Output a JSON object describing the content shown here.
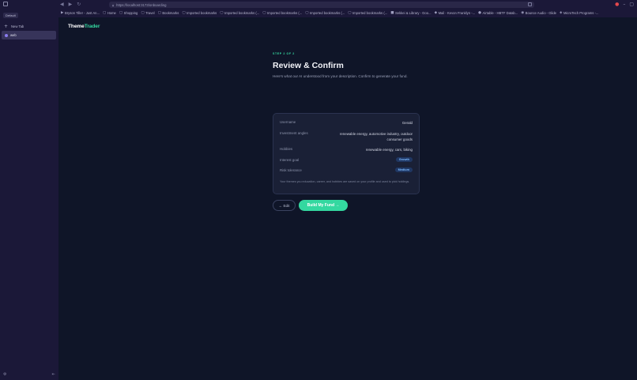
{
  "browser": {
    "url": "https://localhost:3173/onboarding",
    "profile_label": "Default",
    "new_tab_label": "New Tab",
    "active_tab_label": "web",
    "bookmarks": [
      {
        "icon": "▶",
        "label": "Bryson Tiller - Just An..."
      },
      {
        "icon": "▢",
        "label": "Home"
      },
      {
        "icon": "▢",
        "label": "Shopping"
      },
      {
        "icon": "▢",
        "label": "Travel"
      },
      {
        "icon": "▢",
        "label": "Bookmarks"
      },
      {
        "icon": "▢",
        "label": "Imported bookmarks"
      },
      {
        "icon": "▢",
        "label": "Imported bookmarks (..."
      },
      {
        "icon": "▢",
        "label": "Imported bookmarks (..."
      },
      {
        "icon": "▢",
        "label": "Imported bookmarks (..."
      },
      {
        "icon": "▢",
        "label": "Imported bookmarks (..."
      },
      {
        "icon": "■",
        "label": "Sekkei & Library - Goo..."
      },
      {
        "icon": "◆",
        "label": "Mail - Kevon Franklyn -..."
      },
      {
        "icon": "●",
        "label": "Airtable - HBTF Datab..."
      },
      {
        "icon": "◉",
        "label": "Bounce Audio - Glide"
      },
      {
        "icon": "◈",
        "label": "MicroTech Programs -..."
      }
    ]
  },
  "app": {
    "logo_part1": "Theme",
    "logo_part2": "Trader"
  },
  "review": {
    "step": "STEP 2 OF 2",
    "title": "Review & Confirm",
    "subtitle": "Here's what our AI understood from your description. Confirm to generate your fund.",
    "rows": [
      {
        "key": "Username",
        "value": "Gerald"
      },
      {
        "key": "Investment angles",
        "value_line1": "renewable energy, automotive industry, outdoor",
        "value_line2": "consumer goods"
      },
      {
        "key": "Hobbies",
        "value": "renewable energy, cars, biking"
      },
      {
        "key": "Interest goal",
        "badge": "Growth"
      },
      {
        "key": "Risk tolerance",
        "badge": "Medium"
      }
    ],
    "footnote": "Your themes you education, career, and hobbies are saved on your profile and used to pick holdings.",
    "edit_label": "← Edit",
    "build_label": "Build My Fund →"
  }
}
